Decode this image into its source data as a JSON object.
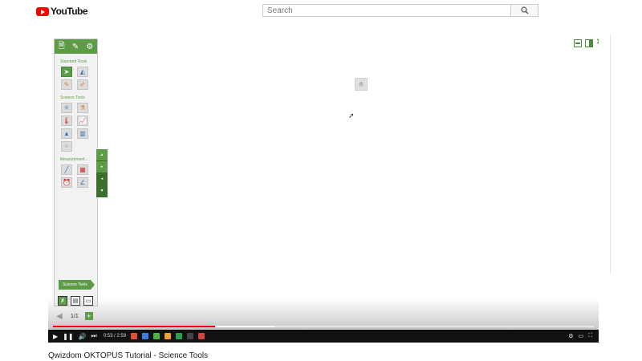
{
  "header": {
    "logo_text": "YouTube",
    "search_placeholder": "Search"
  },
  "player": {
    "current_time": "0:53",
    "duration": "2:59",
    "time_display": "0:53 / 2:59",
    "progress_fraction": 0.3,
    "loaded_fraction": 0.41
  },
  "oktopus": {
    "standard_tools_label": "Standard Tools",
    "science_tools_label": "Science Tools",
    "measurement_label": "Measurement...",
    "current_tool_label": "Science Tools",
    "page_count": "1/1"
  },
  "video_title": "Qwizdom OKTOPUS Tutorial - Science Tools",
  "colors": {
    "accent_green": "#5d9c47",
    "progress_red": "#ee0000",
    "youtube_red": "#ff0000"
  }
}
